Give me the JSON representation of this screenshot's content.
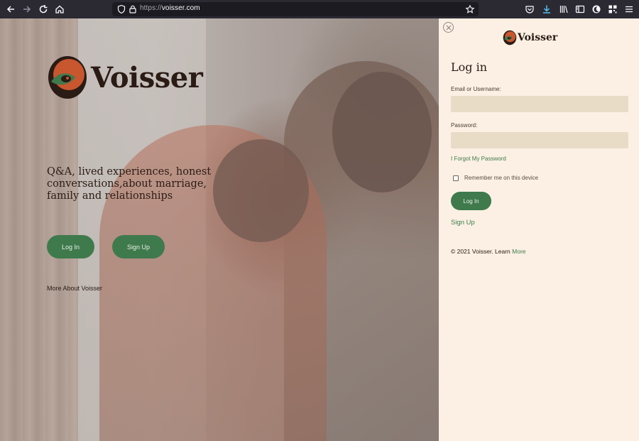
{
  "browser": {
    "url_scheme": "https://",
    "url_host": "voisser.com",
    "icons": {
      "back": "back-arrow-icon",
      "forward": "forward-arrow-icon",
      "reload": "reload-icon",
      "home": "home-icon",
      "shield": "tracking-shield-icon",
      "lock": "lock-icon",
      "bookmark": "bookmark-star-icon",
      "pocket": "pocket-icon",
      "downloads": "download-icon",
      "library": "library-icon",
      "sidebar": "sidebar-icon",
      "dark_mode": "dark-mode-icon",
      "qr": "qr-code-icon",
      "menu": "hamburger-menu-icon"
    }
  },
  "hero": {
    "brand": "Voisser",
    "tagline": "Q&A, lived experiences, honest conversations,about marriage, family and relationships",
    "login_label": "Log In",
    "signup_label": "Sign Up",
    "more_about": "More About Voisser"
  },
  "panel": {
    "brand": "Voisser",
    "title": "Log in",
    "email_label": "Email or Username:",
    "email_value": "",
    "password_label": "Password:",
    "password_value": "",
    "forgot_label": "I Forgot My Password",
    "remember_label": "Remember me on this device",
    "remember_checked": false,
    "login_label": "Log In",
    "signup_label": "Sign Up",
    "footer_text": "© 2021 Voisser. Learn",
    "footer_link": "More"
  },
  "colors": {
    "brand_green": "#3f7a4c",
    "panel_bg": "#fbf0e3",
    "field_bg": "#e9dcc6",
    "logo_orange": "#c8562f",
    "logo_dark": "#2a1b14"
  }
}
